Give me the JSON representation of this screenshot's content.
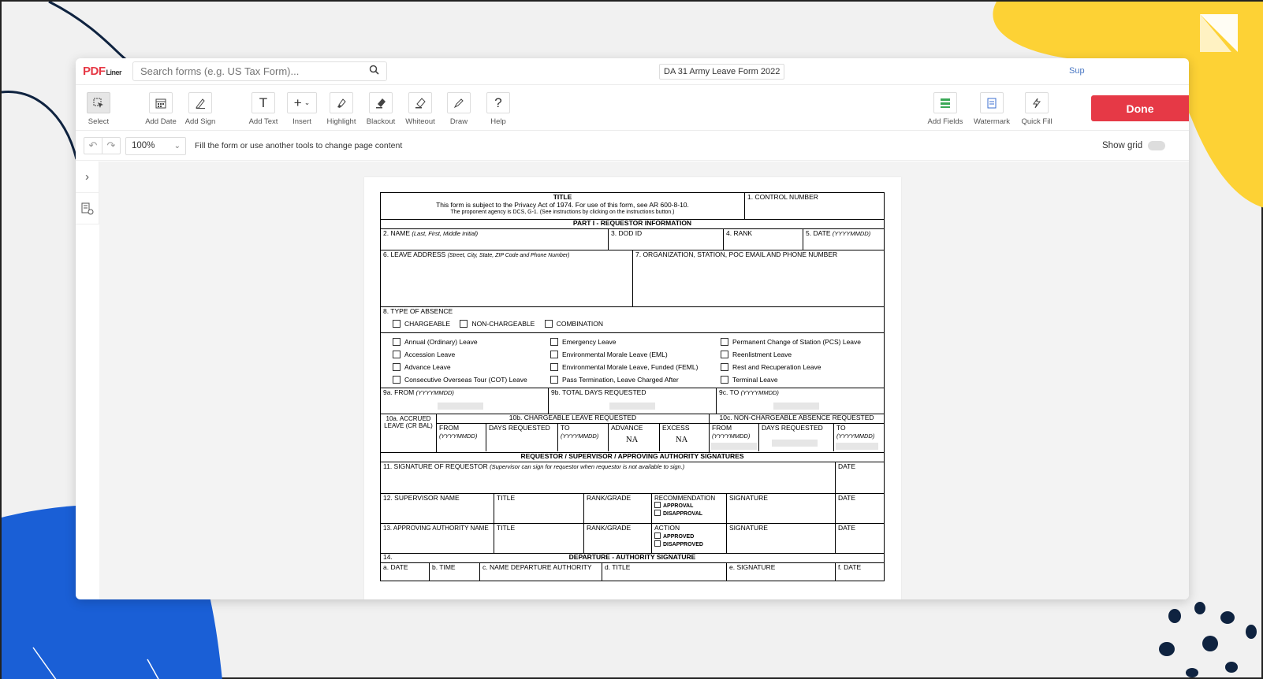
{
  "brand": {
    "name": "PDF",
    "suffix": "Liner"
  },
  "search": {
    "placeholder": "Search forms (e.g. US Tax Form)..."
  },
  "document": {
    "title": "DA 31 Army Leave Form 2022"
  },
  "header_link": "Sup",
  "toolbar": {
    "tools": [
      {
        "label": "Select",
        "icon": "select-icon"
      },
      {
        "label": "Add Date",
        "icon": "calendar-icon"
      },
      {
        "label": "Add Sign",
        "icon": "pen-icon"
      },
      {
        "label": "Add Text",
        "icon": "text-icon"
      },
      {
        "label": "Insert",
        "icon": "plus-icon"
      },
      {
        "label": "Highlight",
        "icon": "highlighter-icon"
      },
      {
        "label": "Blackout",
        "icon": "blackout-icon"
      },
      {
        "label": "Whiteout",
        "icon": "eraser-icon"
      },
      {
        "label": "Draw",
        "icon": "draw-icon"
      },
      {
        "label": "Help",
        "icon": "help-icon"
      }
    ],
    "right_tools": [
      {
        "label": "Add Fields",
        "icon": "fields-icon"
      },
      {
        "label": "Watermark",
        "icon": "watermark-icon"
      },
      {
        "label": "Quick Fill",
        "icon": "lightning-icon"
      }
    ],
    "done_label": "Done"
  },
  "subbar": {
    "zoom": "100%",
    "hint": "Fill the form or use another tools to change page content",
    "show_grid": "Show grid"
  },
  "colors": {
    "accent": "#e63946",
    "yellow": "#fdd235",
    "blue": "#1a5fd6",
    "navy": "#0f2340"
  },
  "form": {
    "title": "TITLE",
    "privacy": "This form is subject to the Privacy Act of 1974. For use of this form, see AR 600-8-10.",
    "proponent": "The proponent agency is DCS, G-1. (See instructions by clicking on the instructions button.)",
    "control_number": "1. CONTROL NUMBER",
    "part1": "PART I - REQUESTOR  INFORMATION",
    "name": "2. NAME",
    "name_hint": "(Last, First, Middle Initial)",
    "dod_id": "3. DOD ID",
    "rank": "4. RANK",
    "date5": "5. DATE",
    "date_hint": "(YYYYMMDD)",
    "leave_address": "6. LEAVE ADDRESS",
    "leave_address_hint": "(Street, City, State, ZIP Code and Phone Number)",
    "organization": "7. ORGANIZATION, STATION, POC EMAIL AND PHONE NUMBER",
    "type_of_absence": "8. TYPE OF ABSENCE",
    "absence_options": [
      "CHARGEABLE",
      "NON-CHARGEABLE",
      "COMBINATION"
    ],
    "leave_col1": [
      "Annual (Ordinary) Leave",
      "Accession Leave",
      "Advance Leave",
      "Consecutive Overseas Tour (COT) Leave"
    ],
    "leave_col2": [
      "Emergency Leave",
      "Environmental Morale Leave (EML)",
      "Environmental Morale Leave, Funded (FEML)",
      "Pass Termination, Leave Charged After"
    ],
    "leave_col3": [
      "Permanent Change of Station (PCS) Leave",
      "Reenlistment Leave",
      "Rest and Recuperation Leave",
      "Terminal Leave"
    ],
    "from9a": "9a. FROM",
    "total9b": "9b. TOTAL DAYS REQUESTED",
    "to9c": "9c. TO",
    "accrued": "10a. ACCRUED LEAVE (CR BAL)",
    "chargeable": "10b. CHARGEABLE LEAVE REQUESTED",
    "nonchargeable": "10c. NON-CHARGEABLE ABSENCE REQUESTED",
    "from": "FROM",
    "days_requested": "DAYS REQUESTED",
    "to": "TO",
    "advance": "ADVANCE",
    "excess": "EXCESS",
    "na": "NA",
    "signatures_header": "REQUESTOR / SUPERVISOR / APPROVING AUTHORITY SIGNATURES",
    "sig11": "11.  SIGNATURE OF REQUESTOR",
    "sig11_hint": "(Supervisor can sign for requestor when requestor is not available to sign.)",
    "date": "DATE",
    "supervisor": "12. SUPERVISOR NAME",
    "rank_grade": "RANK/GRADE",
    "recommendation": "RECOMMENDATION",
    "approval": "APPROVAL",
    "disapproval": "DISAPPROVAL",
    "signature": "SIGNATURE",
    "approving": "13. APPROVING AUTHORITY NAME",
    "action": "ACTION",
    "approved": "APPROVED",
    "disapproved": "DISAPPROVED",
    "num14": "14.",
    "departure": "DEPARTURE - AUTHORITY SIGNATURE",
    "dep_cols": [
      "a. DATE",
      "b. TIME",
      "c. NAME DEPARTURE AUTHORITY",
      "d. TITLE",
      "e. SIGNATURE",
      "f. DATE"
    ]
  }
}
